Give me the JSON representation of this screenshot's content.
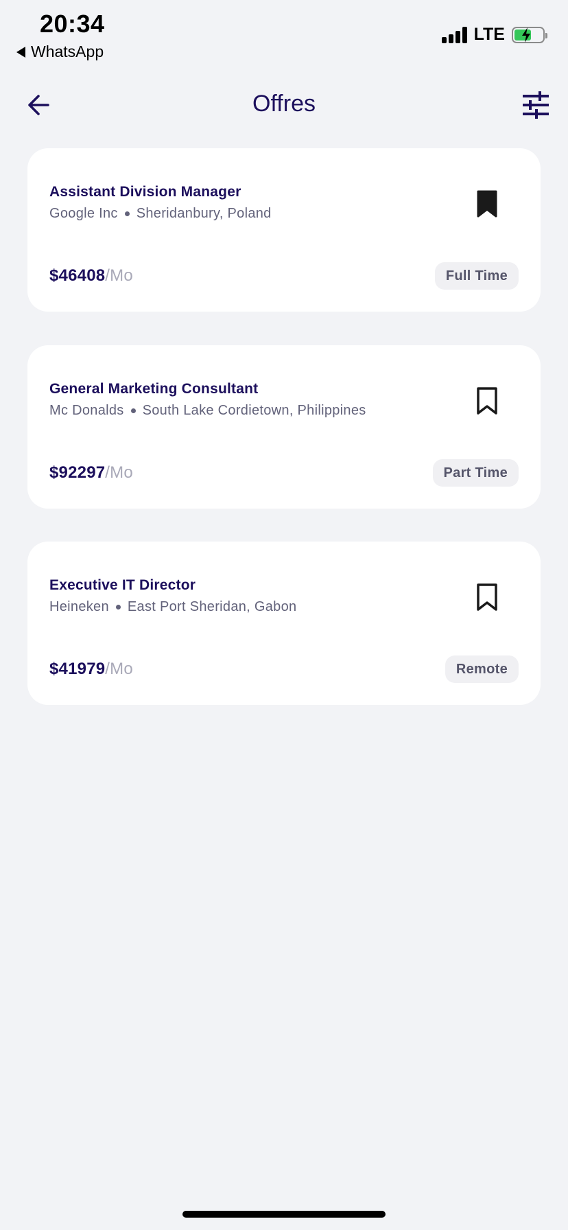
{
  "status_bar": {
    "time": "20:34",
    "back_app": "WhatsApp",
    "network": "LTE",
    "battery_color": "#34c759"
  },
  "header": {
    "title": "Offres",
    "back_icon": "arrow-left-icon",
    "filter_icon": "sliders-icon"
  },
  "offers": [
    {
      "title": "Assistant Division Manager",
      "company": "Google Inc",
      "location": "Sheridanbury, Poland",
      "salary": "$46408",
      "period": "/Mo",
      "type": "Full Time",
      "bookmarked": true
    },
    {
      "title": "General Marketing Consultant",
      "company": "Mc Donalds",
      "location": "South Lake Cordietown, Philippines",
      "salary": "$92297",
      "period": "/Mo",
      "type": "Part Time",
      "bookmarked": false
    },
    {
      "title": "Executive IT Director",
      "company": "Heineken",
      "location": "East Port Sheridan, Gabon",
      "salary": "$41979",
      "period": "/Mo",
      "type": "Remote",
      "bookmarked": false
    }
  ],
  "colors": {
    "accent": "#1c0f5c",
    "background": "#f2f3f6",
    "card": "#ffffff",
    "muted": "#a9a9b8"
  }
}
